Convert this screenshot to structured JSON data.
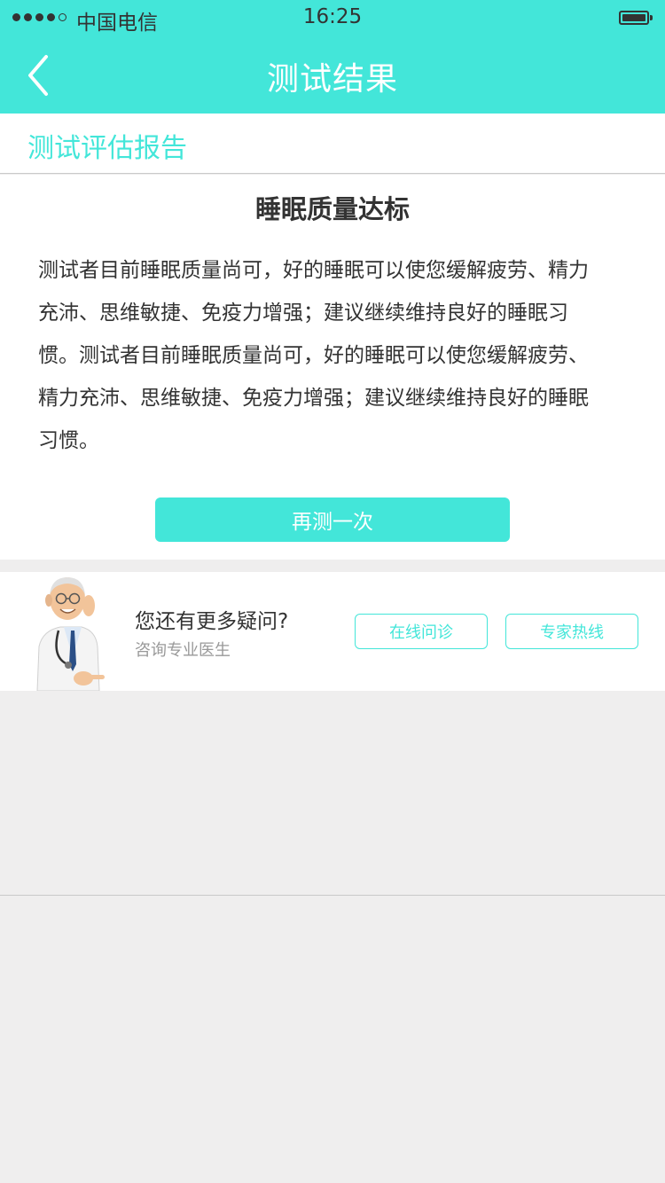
{
  "status_bar": {
    "carrier": "中国电信",
    "time": "16:25",
    "signal_dots_filled": 4,
    "signal_dots_total": 5,
    "battery_level": 1.0
  },
  "nav": {
    "back_icon": "chevron-left-icon",
    "title": "测试结果"
  },
  "report": {
    "section_title": "测试评估报告",
    "headline": "睡眠质量达标",
    "body": "测试者目前睡眠质量尚可，好的睡眠可以使您缓解疲劳、精力充沛、思维敏捷、免疫力增强；建议继续维持良好的睡眠习惯。测试者目前睡眠质量尚可，好的睡眠可以使您缓解疲劳、精力充沛、思维敏捷、免疫力增强；建议继续维持良好的睡眠习惯。",
    "retest_label": "再测一次"
  },
  "consult": {
    "avatar_icon": "doctor-illustration",
    "question": "您还有更多疑问?",
    "subtitle": "咨询专业医生",
    "online_label": "在线问诊",
    "hotline_label": "专家热线"
  },
  "colors": {
    "accent": "#43e6d9",
    "background": "#efeeee",
    "text_primary": "#333333",
    "text_secondary": "#999999"
  }
}
